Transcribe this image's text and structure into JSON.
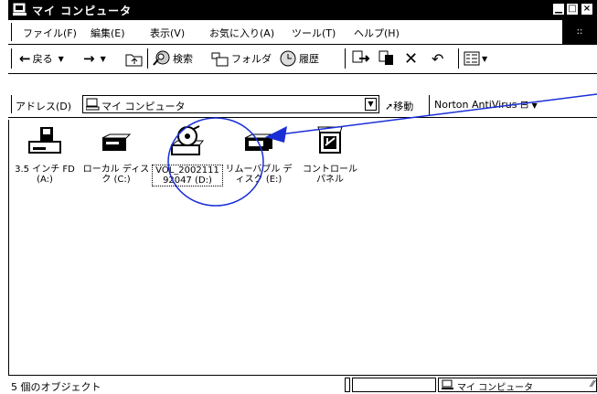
{
  "window": {
    "title": "マイ コンピュータ",
    "minimize": "▁",
    "maximize": "□",
    "close": "×"
  },
  "menu": [
    "ファイル(F)",
    "編集(E)",
    "表示(V)",
    "お気に入り(A)",
    "ツール(T)",
    "ヘルプ(H)"
  ],
  "throbber": "::",
  "toolbar": {
    "back": "戻る",
    "search": "検索",
    "folders": "フォルダ",
    "history": "履歴"
  },
  "address": {
    "label": "アドレス(D)",
    "value": "マイ コンピュータ",
    "go": "移動",
    "norton": "Norton AntiVirus"
  },
  "items": [
    {
      "icon": "floppy-drive-icon",
      "label": "3.5 インチ FD\n(A:)"
    },
    {
      "icon": "hard-drive-icon",
      "label": "ローカル ディス\nク (C:)"
    },
    {
      "icon": "cd-drive-icon",
      "label": "VOL_2002111\n92047 (D:)"
    },
    {
      "icon": "removable-drive-icon",
      "label": "リムーバブル デ\nィスク (E:)"
    },
    {
      "icon": "control-panel-icon",
      "label": "コントロール\nパネル"
    }
  ],
  "status": {
    "count": "5 個のオブジェクト",
    "location": "マイ コンピュータ"
  },
  "colors": {
    "titlebar": "#000000",
    "annotation": "#1a2fd6"
  }
}
